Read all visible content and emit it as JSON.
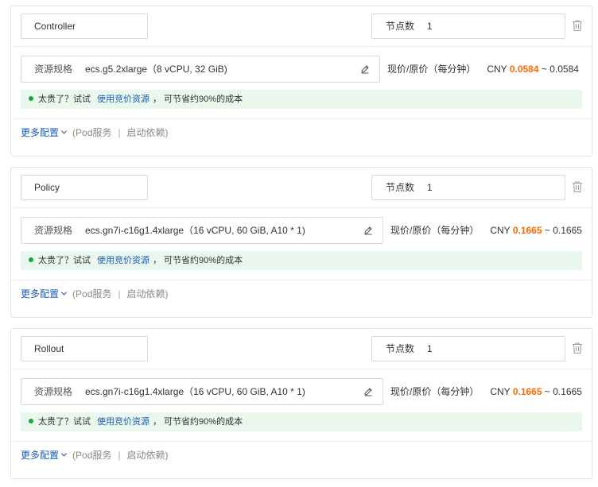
{
  "labels": {
    "nodes": "节点数",
    "spec": "资源规格",
    "price_label": "现价/原价（每分钟）",
    "currency": "CNY",
    "tilde": "~",
    "tip_prefix": "太贵了？试试",
    "tip_link": "使用竞价资源",
    "tip_suffix": "，  可节省约90%的成本",
    "more_config": "更多配置",
    "pod_service": "(Pod服务",
    "separator": "|",
    "startup_deps": "启动依赖)"
  },
  "roles": [
    {
      "name": "Controller",
      "node_count": "1",
      "spec": "ecs.g5.2xlarge（8 vCPU, 32 GiB)",
      "price_current": "0.0584",
      "price_original": "0.0584"
    },
    {
      "name": "Policy",
      "node_count": "1",
      "spec": "ecs.gn7i-c16g1.4xlarge（16 vCPU, 60 GiB, A10 * 1)",
      "price_current": "0.1665",
      "price_original": "0.1665"
    },
    {
      "name": "Rollout",
      "node_count": "1",
      "spec": "ecs.gn7i-c16g1.4xlarge（16 vCPU, 60 GiB, A10 * 1)",
      "price_current": "0.1665",
      "price_original": "0.1665"
    }
  ],
  "colors": {
    "accent_price": "#ff6a00",
    "link": "#1a5cb8",
    "tip_bg": "#e9f7ec",
    "tip_dot": "#1aa14a"
  },
  "icons": {
    "delete": "trash-icon",
    "edit": "edit-icon",
    "expand": "chevron-down-icon",
    "status": "status-dot-icon"
  }
}
